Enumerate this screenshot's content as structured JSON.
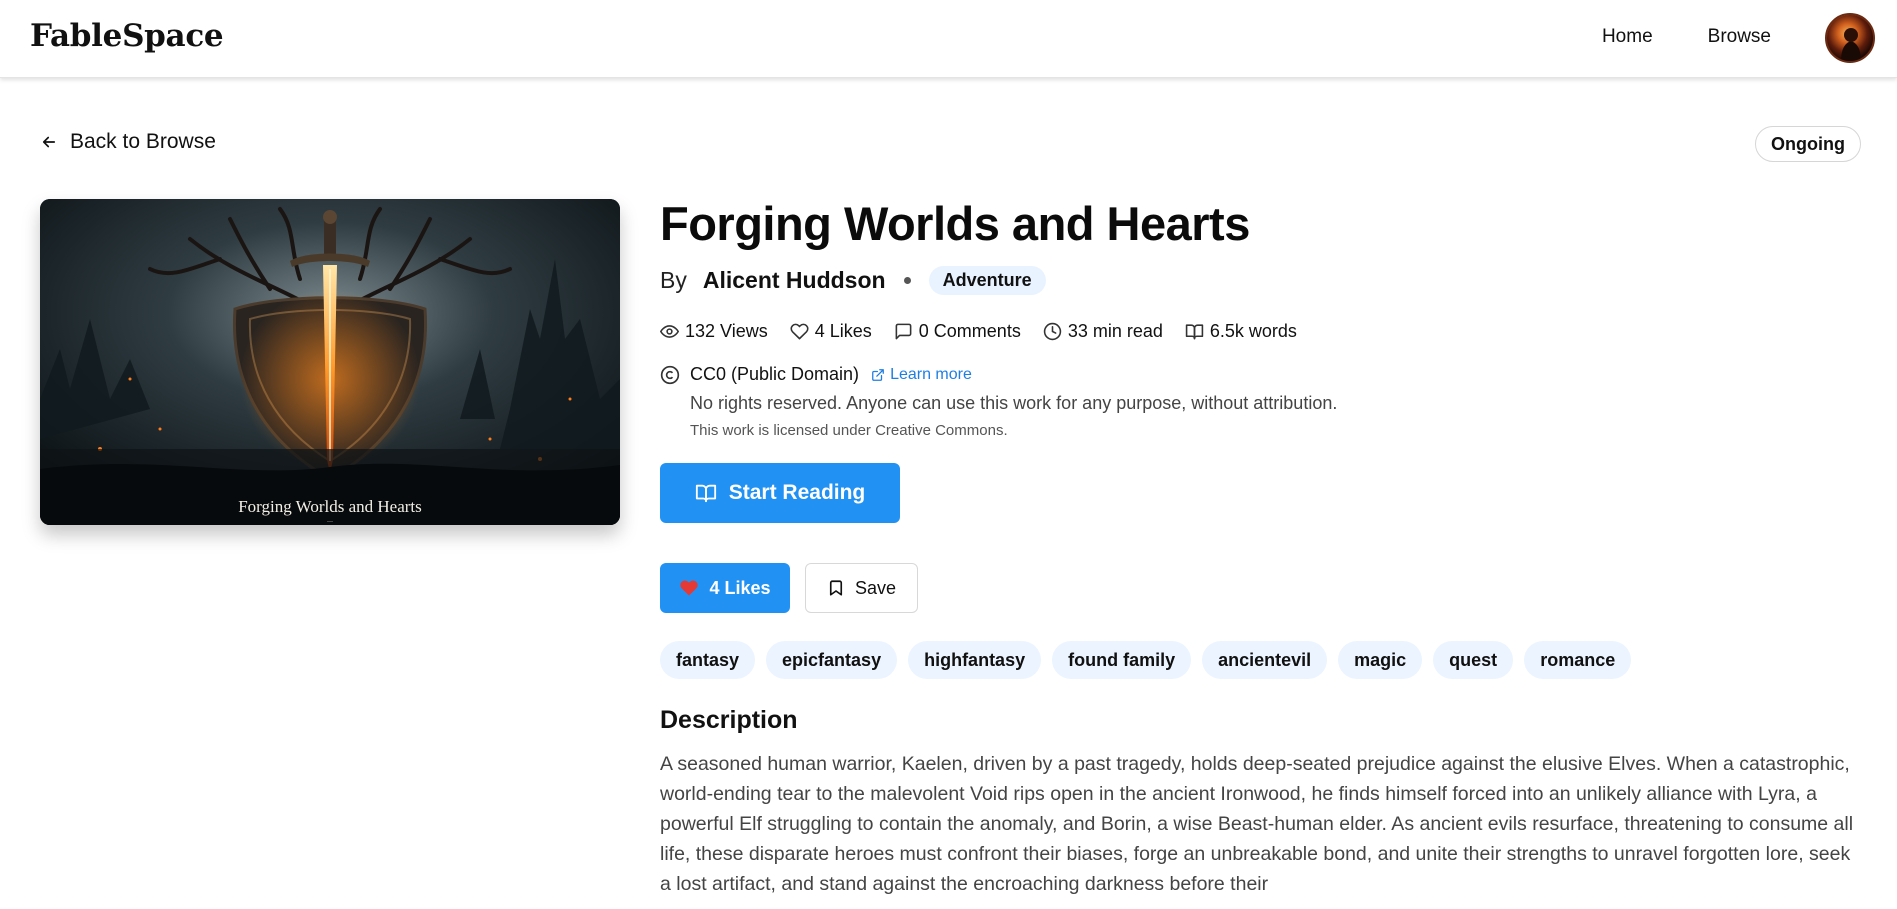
{
  "header": {
    "logo": "FableSpace",
    "nav": [
      {
        "label": "Home"
      },
      {
        "label": "Browse"
      }
    ]
  },
  "back_label": "Back to Browse",
  "status": "Ongoing",
  "cover": {
    "title": "Forging Worlds and Hearts",
    "subtitle": "..."
  },
  "story": {
    "title": "Forging Worlds and Hearts",
    "by": "By",
    "author": "Alicent Huddson",
    "genre": "Adventure",
    "stats": {
      "views": "132 Views",
      "likes": "4 Likes",
      "comments": "0 Comments",
      "read_time": "33 min read",
      "words": "6.5k words"
    },
    "license": {
      "name": "CC0 (Public Domain)",
      "learn_more": "Learn more",
      "description": "No rights reserved. Anyone can use this work for any purpose, without attribution.",
      "note": "This work is licensed under Creative Commons."
    },
    "start_label": "Start Reading",
    "like_label": "4 Likes",
    "save_label": "Save",
    "tags": [
      "fantasy",
      "epicfantasy",
      "highfantasy",
      "found family",
      "ancientevil",
      "magic",
      "quest",
      "romance"
    ],
    "description_heading": "Description",
    "description": "A seasoned human warrior, Kaelen, driven by a past tragedy, holds deep-seated prejudice against the elusive Elves. When a catastrophic, world-ending tear to the malevolent Void rips open in the ancient Ironwood, he finds himself forced into an unlikely alliance with Lyra, a powerful Elf struggling to contain the anomaly, and Borin, a wise Beast-human elder. As ancient evils resurface, threatening to consume all life, these disparate heroes must confront their biases, forge an unbreakable bond, and unite their strengths to unravel forgotten lore, seek a lost artifact, and stand against the encroaching darkness before their"
  },
  "colors": {
    "accent": "#2192f3",
    "tag_bg": "#ebf4ff",
    "link": "#1e7fe3"
  }
}
